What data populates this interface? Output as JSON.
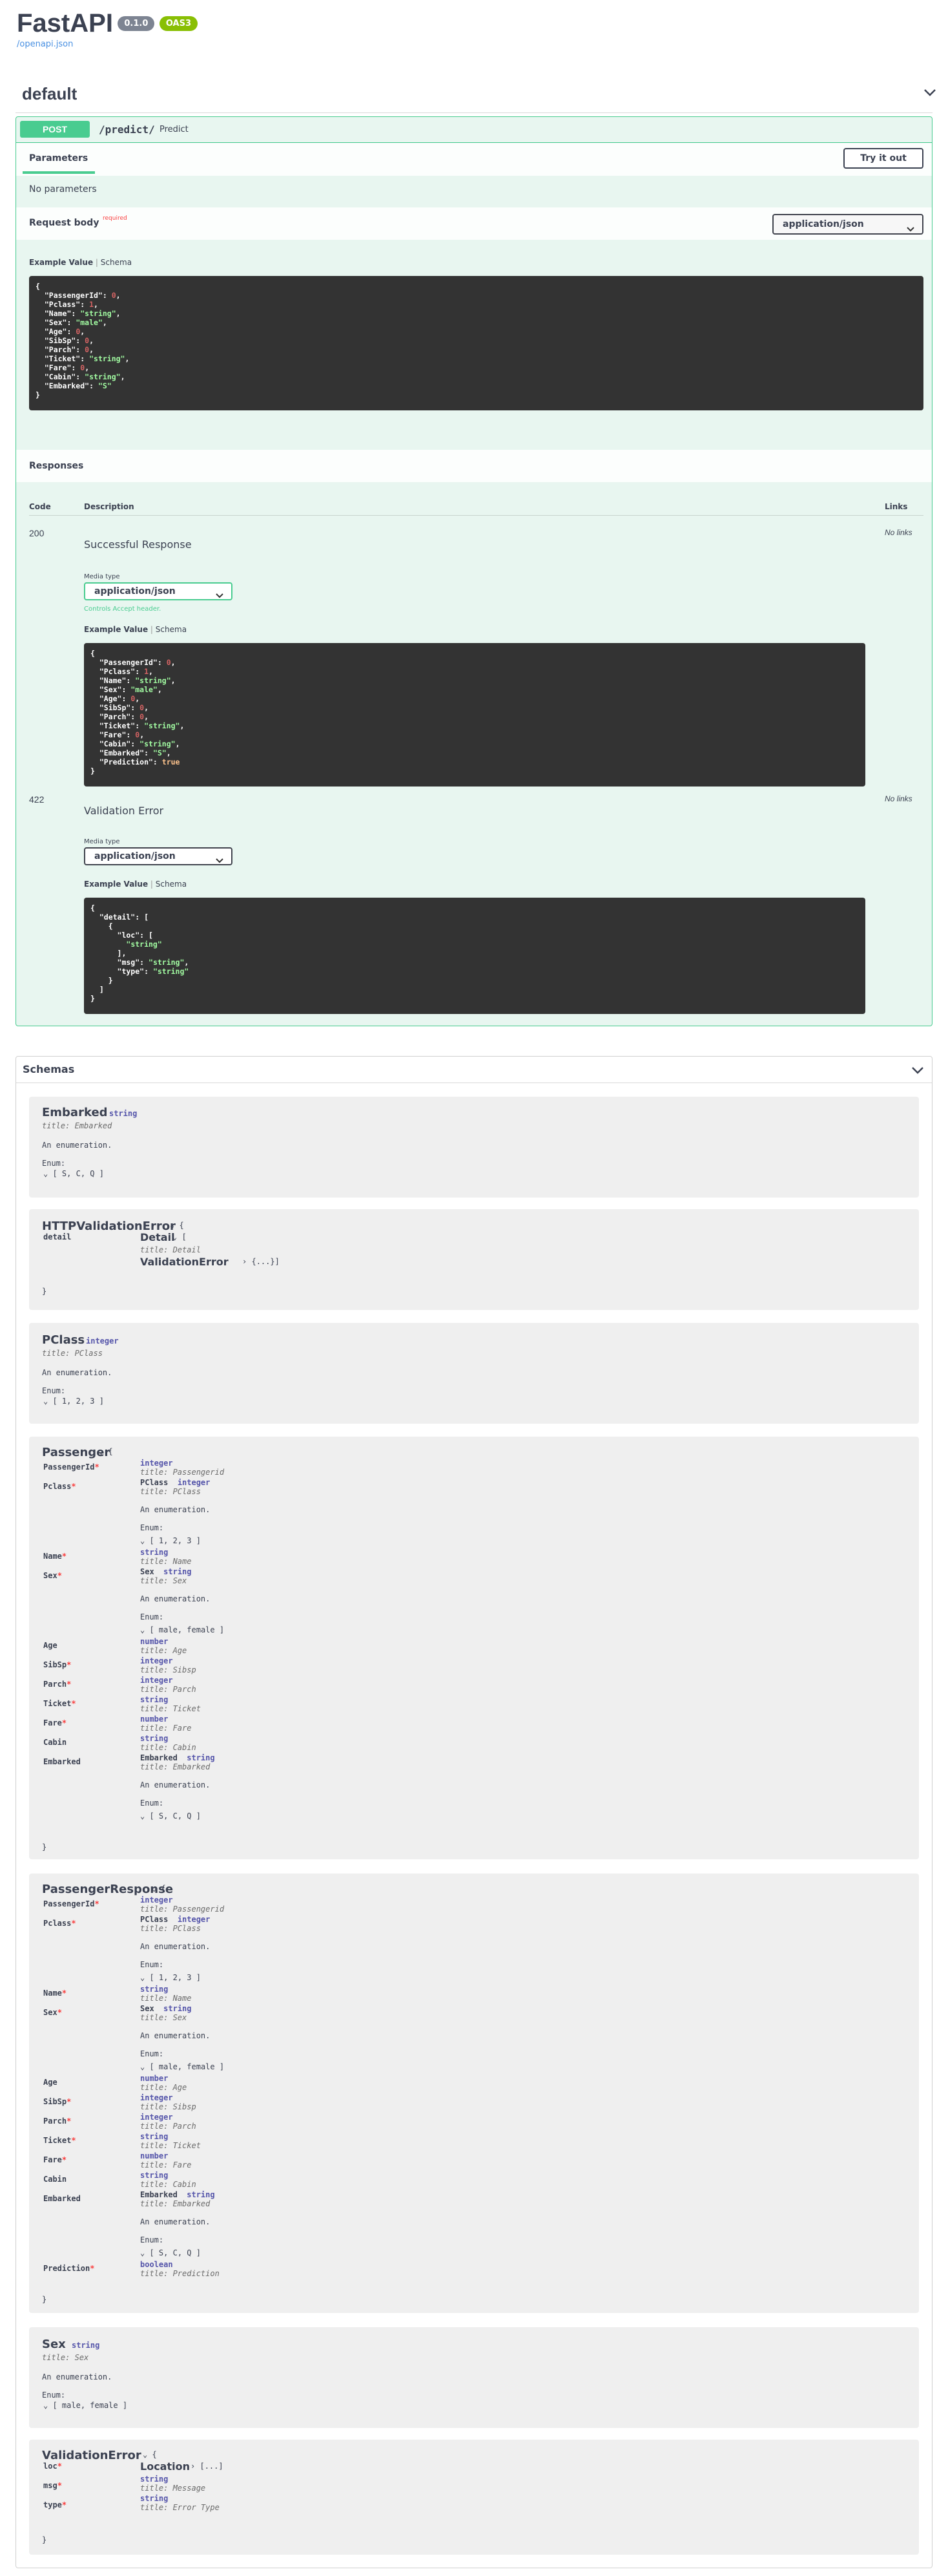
{
  "header": {
    "title": "FastAPI",
    "version": "0.1.0",
    "oas": "OAS3",
    "link": "/openapi.json"
  },
  "default_section": {
    "title": "default"
  },
  "operation": {
    "method": "POST",
    "path": "/predict/",
    "summary": "Predict",
    "parameters_tab": "Parameters",
    "try_button": "Try it out",
    "no_params": "No parameters",
    "request_body_label": "Request body",
    "required_label": "required",
    "content_type": "application/json",
    "example_value_tab": "Example Value",
    "schema_tab": "Schema",
    "request_example": [
      "{",
      "  \"PassengerId\": 0,",
      "  \"Pclass\": 1,",
      "  \"Name\": \"string\",",
      "  \"Sex\": \"male\",",
      "  \"Age\": 0,",
      "  \"SibSp\": 0,",
      "  \"Parch\": 0,",
      "  \"Ticket\": \"string\",",
      "  \"Fare\": 0,",
      "  \"Cabin\": \"string\",",
      "  \"Embarked\": \"S\"",
      "}"
    ],
    "responses_title": "Responses",
    "col_code": "Code",
    "col_description": "Description",
    "col_links": "Links",
    "responses": [
      {
        "code": "200",
        "description": "Successful Response",
        "links": "No links",
        "media_type_label": "Media type",
        "media_type": "application/json",
        "accept_note": "Controls Accept header.",
        "example": [
          "{",
          "  \"PassengerId\": 0,",
          "  \"Pclass\": 1,",
          "  \"Name\": \"string\",",
          "  \"Sex\": \"male\",",
          "  \"Age\": 0,",
          "  \"SibSp\": 0,",
          "  \"Parch\": 0,",
          "  \"Ticket\": \"string\",",
          "  \"Fare\": 0,",
          "  \"Cabin\": \"string\",",
          "  \"Embarked\": \"S\",",
          "  \"Prediction\": true",
          "}"
        ]
      },
      {
        "code": "422",
        "description": "Validation Error",
        "links": "No links",
        "media_type_label": "Media type",
        "media_type": "application/json",
        "example": [
          "{",
          "  \"detail\": [",
          "    {",
          "      \"loc\": [",
          "        \"string\"",
          "      ],",
          "      \"msg\": \"string\",",
          "      \"type\": \"string\"",
          "    }",
          "  ]",
          "}"
        ]
      }
    ]
  },
  "schemas": {
    "title": "Schemas",
    "embarked": {
      "name": "Embarked",
      "type": "string",
      "title": "title: Embarked",
      "desc": "An enumeration.",
      "enum_label": "Enum:",
      "enum": "[ S, C, Q ]"
    },
    "httpve": {
      "name": "HTTPValidationError",
      "brace_open": "{",
      "prop": "detail",
      "detail_name": "Detail",
      "detail_open": "[",
      "detail_title": "title: Detail",
      "ve_name": "ValidationError",
      "ve_collapsed": "{...}]",
      "brace_close": "}"
    },
    "pclass": {
      "name": "PClass",
      "type": "integer",
      "title": "title: PClass",
      "desc": "An enumeration.",
      "enum_label": "Enum:",
      "enum": "[ 1, 2, 3 ]"
    },
    "passenger": {
      "name": "Passenger",
      "brace_open": "{",
      "brace_close": "}"
    },
    "passenger_response": {
      "name": "PassengerResponse",
      "brace_open": "{",
      "brace_close": "}"
    },
    "sex": {
      "name": "Sex",
      "type": "string",
      "title": "title: Sex",
      "desc": "An enumeration.",
      "enum_label": "Enum:",
      "enum": "[ male, female ]"
    },
    "validation_error": {
      "name": "ValidationError",
      "brace_open": "{",
      "loc": "loc",
      "msg": "msg",
      "type_prop": "type",
      "location_name": "Location",
      "location_collapsed": "[...]",
      "msg_type": "string",
      "msg_title": "title: Message",
      "type_type": "string",
      "type_title": "title: Error Type",
      "brace_close": "}"
    },
    "props": {
      "passengerid": "PassengerId",
      "pclass": "Pclass",
      "name": "Name",
      "sex": "Sex",
      "age": "Age",
      "sibsp": "SibSp",
      "parch": "Parch",
      "ticket": "Ticket",
      "fare": "Fare",
      "cabin": "Cabin",
      "embarked": "Embarked",
      "prediction": "Prediction",
      "integer": "integer",
      "string": "string",
      "number": "number",
      "boolean": "boolean",
      "t_passengerid": "title: Passengerid",
      "t_pclass": "title: PClass",
      "t_name": "title: Name",
      "t_sex": "title: Sex",
      "t_age": "title: Age",
      "t_sibsp": "title: Sibsp",
      "t_parch": "title: Parch",
      "t_ticket": "title: Ticket",
      "t_fare": "title: Fare",
      "t_cabin": "title: Cabin",
      "t_embarked": "title: Embarked",
      "t_prediction": "title: Prediction",
      "pclass_ref": "PClass",
      "sex_ref": "Sex",
      "embarked_ref": "Embarked",
      "desc": "An enumeration.",
      "enum_label": "Enum:",
      "enum_pclass": "[ 1, 2, 3 ]",
      "enum_sex": "[ male, female ]",
      "enum_embarked": "[ S, C, Q ]"
    }
  }
}
